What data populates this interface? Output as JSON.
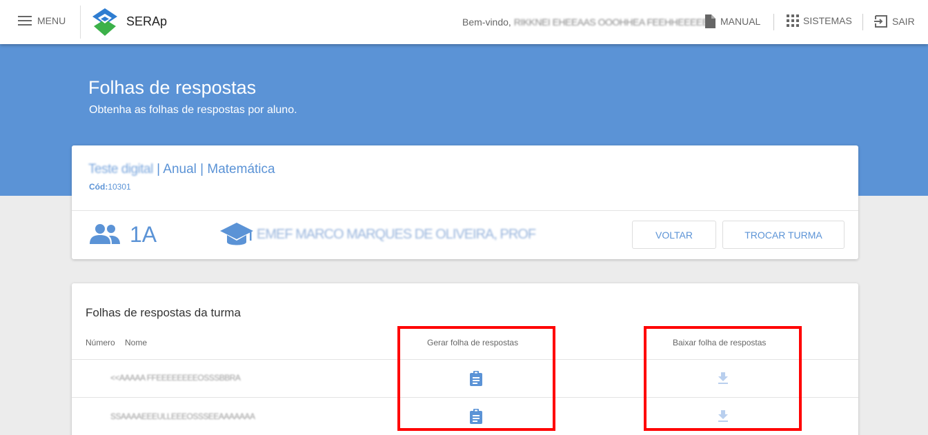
{
  "topbar": {
    "menu_label": "MENU",
    "brand": "SERAp",
    "welcome_prefix": "Bem-vindo,",
    "user_name": "RIKKNEI EHEEAAS OOOHHEA  FEEHHEEEEE",
    "manual_label": "MANUAL",
    "sistemas_label": "SISTEMAS",
    "sair_label": "SAIR"
  },
  "hero": {
    "title": "Folhas de respostas",
    "subtitle": "Obtenha as folhas de respostas por aluno."
  },
  "test": {
    "name": "Teste digital",
    "details": " | Anual | Matemática",
    "cod_label": "Cód:",
    "cod_value": "10301"
  },
  "turma": {
    "name": "1A",
    "school": "EMEF MARCO MARQUES DE OLIVEIRA, PROF"
  },
  "buttons": {
    "voltar": "VOLTAR",
    "trocar": "TROCAR TURMA"
  },
  "table": {
    "title": "Folhas de respostas da turma",
    "headers": {
      "numero": "Número",
      "nome": "Nome",
      "gerar": "Gerar folha de respostas",
      "baixar": "Baixar folha de respostas"
    },
    "rows": [
      {
        "name": "<<AAAAA FFEEEEEEEEOSSSBBRA"
      },
      {
        "name": "SSAAAAEEEULLEEEOSSSEEAAAAAAA"
      }
    ]
  },
  "colors": {
    "primary": "#5b93d6",
    "highlight": "#ff0000",
    "download_disabled": "#b9cfee"
  },
  "icons": [
    "menu-icon",
    "logo-icon",
    "document-icon",
    "apps-grid-icon",
    "exit-icon",
    "group-icon",
    "school-icon",
    "clipboard-icon",
    "download-icon"
  ]
}
